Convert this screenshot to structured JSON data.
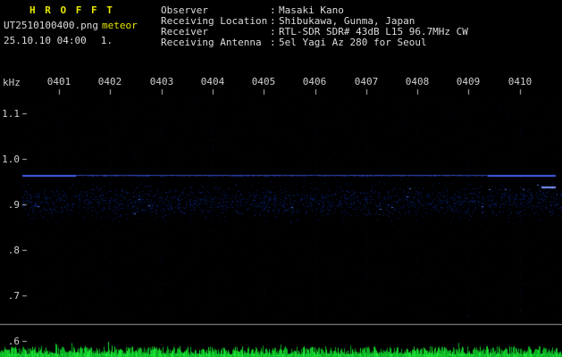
{
  "app": {
    "title": "H R O F F T"
  },
  "header": {
    "filename": "UT2510100400.png",
    "mode": "meteor",
    "datetime": "25.10.10 04:00",
    "counter": "1.",
    "info": [
      {
        "label": "Observer",
        "value": "Masaki Kano"
      },
      {
        "label": "Receiving Location",
        "value": "Shibukawa, Gunma, Japan"
      },
      {
        "label": "Receiver",
        "value": "RTL-SDR SDR# 43dB L15 96.7MHz CW"
      },
      {
        "label": "Receiving Antenna",
        "value": "5el Yagi Az 280 for Seoul"
      }
    ]
  },
  "ui": {
    "colon": ":"
  },
  "chart_data": {
    "type": "heatmap",
    "subtype": "radio-meteor-spectrogram",
    "title": "",
    "xlabel": "",
    "ylabel": "kHz",
    "x_ticks": [
      "0401",
      "0402",
      "0403",
      "0404",
      "0405",
      "0406",
      "0407",
      "0408",
      "0409",
      "0410"
    ],
    "y_ticks": [
      "1.1",
      "1.0",
      ".9",
      ".8",
      ".7",
      ".6"
    ],
    "ylim_khz": [
      0.57,
      1.15
    ],
    "grid": false,
    "legend": false,
    "features": {
      "carrier_khz": 0.965,
      "carrier_color": "#4664ff",
      "noise_band_khz": [
        0.87,
        0.94
      ],
      "noise_speckle_color": "#0f37be",
      "background_color": "#000000"
    },
    "level_strip": {
      "description": "received signal level vs time",
      "trace_color": "#0bb022",
      "baseline_color": "#9a9a9a"
    }
  },
  "colors": {
    "accent_yellow": "#e6e600",
    "text_white": "#dcdcdc"
  }
}
